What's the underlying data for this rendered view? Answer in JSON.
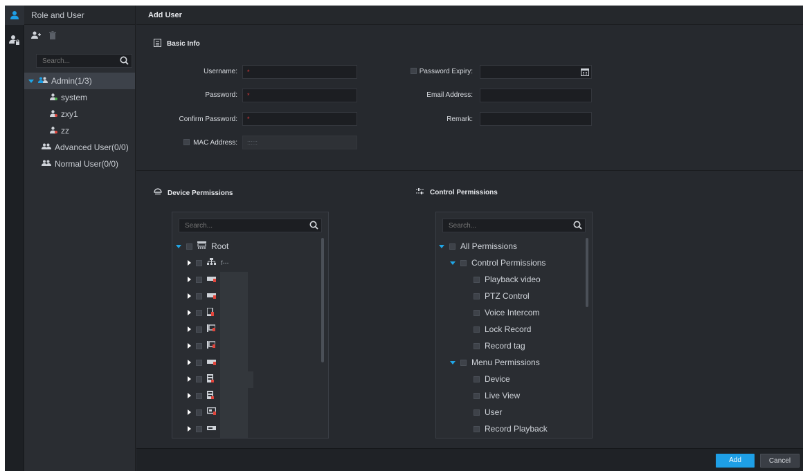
{
  "left_panel": {
    "title": "Role and User",
    "search_placeholder": "Search...",
    "tree": [
      {
        "label": "Admin(1/3)",
        "children": [
          "system",
          "zxy1",
          "zz"
        ]
      },
      {
        "label": "Advanced User(0/0)"
      },
      {
        "label": "Normal User(0/0)"
      }
    ]
  },
  "main": {
    "title": "Add User",
    "basic_info": {
      "title": "Basic Info",
      "username_label": "Username:",
      "password_label": "Password:",
      "confirm_password_label": "Confirm Password:",
      "mac_address_label": "MAC Address:",
      "mac_placeholder": "::::::",
      "required_mark": "*",
      "password_expiry_label": "Password Expiry:",
      "email_label": "Email Address:",
      "remark_label": "Remark:"
    },
    "device_permissions": {
      "title": "Device Permissions",
      "search_placeholder": "Search...",
      "root_label": "Root",
      "first_child_label": "f---"
    },
    "control_permissions": {
      "title": "Control Permissions",
      "search_placeholder": "Search...",
      "items": [
        {
          "label": "All Permissions",
          "level": 0,
          "expanded": true
        },
        {
          "label": "Control Permissions",
          "level": 1,
          "expanded": true
        },
        {
          "label": "Playback video",
          "level": 2
        },
        {
          "label": "PTZ Control",
          "level": 2
        },
        {
          "label": "Voice Intercom",
          "level": 2
        },
        {
          "label": "Lock Record",
          "level": 2
        },
        {
          "label": "Record tag",
          "level": 2
        },
        {
          "label": "Menu Permissions",
          "level": 1,
          "expanded": true
        },
        {
          "label": "Device",
          "level": 2
        },
        {
          "label": "Live View",
          "level": 2
        },
        {
          "label": "User",
          "level": 2
        },
        {
          "label": "Record Playback",
          "level": 2
        }
      ]
    }
  },
  "footer": {
    "add_label": "Add",
    "cancel_label": "Cancel"
  },
  "colors": {
    "accent": "#1e9fe6",
    "background": "#26292e",
    "required": "#d93a3a"
  }
}
